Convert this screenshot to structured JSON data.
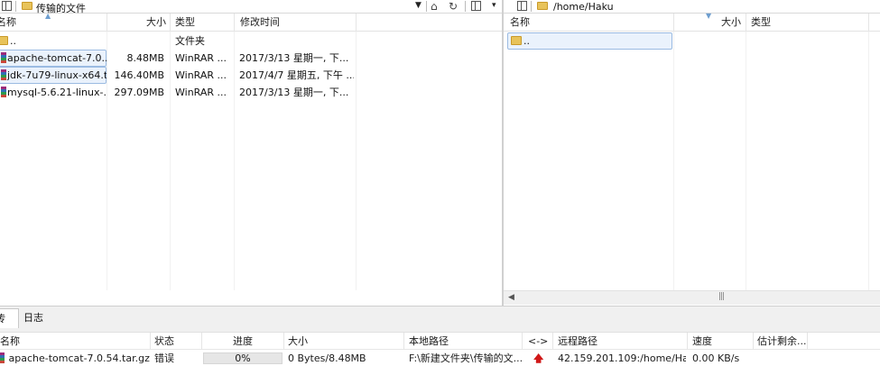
{
  "left_pane": {
    "path": "传输的文件",
    "headers": {
      "name": "名称",
      "size": "大小",
      "type": "类型",
      "modified": "修改时间"
    },
    "files": [
      {
        "name": "..",
        "size": "",
        "type": "文件夹",
        "modified": "",
        "icon": "folder-icon"
      },
      {
        "name": "apache-tomcat-7.0....",
        "size": "8.48MB",
        "type": "WinRAR ...",
        "modified": "2017/3/13 星期一, 下...",
        "icon": "winrar-archive-icon"
      },
      {
        "name": "jdk-7u79-linux-x64.t...",
        "size": "146.40MB",
        "type": "WinRAR ...",
        "modified": "2017/4/7 星期五, 下午 ...",
        "icon": "winrar-archive-icon"
      },
      {
        "name": "mysql-5.6.21-linux-...",
        "size": "297.09MB",
        "type": "WinRAR ...",
        "modified": "2017/3/13 星期一, 下...",
        "icon": "winrar-archive-icon"
      }
    ]
  },
  "right_pane": {
    "path": "/home/Haku",
    "headers": {
      "name": "名称",
      "size": "大小",
      "type": "类型"
    },
    "files": [
      {
        "name": "..",
        "icon": "folder-icon"
      }
    ]
  },
  "transfer_panel": {
    "tabs": [
      {
        "label": "传输",
        "active": true
      },
      {
        "label": "日志",
        "active": false
      }
    ],
    "headers": {
      "name": "名称",
      "status": "状态",
      "progress": "进度",
      "size": "大小",
      "local_path": "本地路径",
      "direction": "<->",
      "remote_path": "远程路径",
      "speed": "速度",
      "eta": "估计剩余..."
    },
    "rows": [
      {
        "name": "apache-tomcat-7.0.54.tar.gz",
        "status": "错误",
        "progress_pct": 0,
        "progress_label": "0%",
        "size": "0 Bytes/8.48MB",
        "local_path": "F:\\新建文件夹\\传输的文...",
        "direction_icon": "upload-arrow-icon",
        "remote_path": "42.159.201.109:/home/Ha...",
        "speed": "0.00 KB/s",
        "eta": ""
      }
    ]
  },
  "colors": {
    "selection": "#eaf2fc",
    "selection_border": "#9bbbe2",
    "upload_arrow": "#d01818",
    "folder": "#e8c35a"
  }
}
